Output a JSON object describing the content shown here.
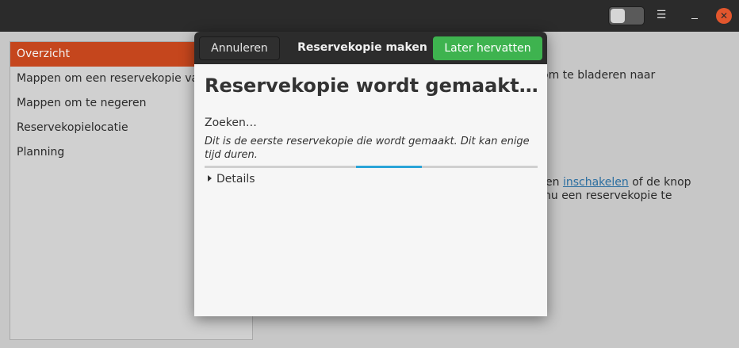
{
  "window": {
    "toggle_state": "off",
    "menu_icon": "hamburger-menu-icon",
    "close_color": "#e2562d"
  },
  "sidebar": {
    "items": [
      {
        "label": "Overzicht",
        "active": true
      },
      {
        "label": "Mappen om een reservekopie van te maken"
      },
      {
        "label": "Mappen om te negeren"
      },
      {
        "label": "Reservekopielocatie"
      },
      {
        "label": "Planning"
      }
    ]
  },
  "background": {
    "line1": "om te bladeren naar",
    "line2_link": "inschakelen",
    "line2_prefix": "en",
    "line2_suffix": "of de knop",
    "line3": "nu een reservekopie te"
  },
  "dialog": {
    "cancel_label": "Annuleren",
    "title": "Reservekopie maken",
    "resume_label": "Later hervatten",
    "heading": "Reservekopie wordt gemaakt…",
    "status": "Zoeken…",
    "note": "Dit is de eerste reservekopie die wordt gemaakt. Dit kan enige tijd duren.",
    "details_label": "Details",
    "progress_color": "#2aa4d8",
    "resume_color": "#3eb34f"
  }
}
